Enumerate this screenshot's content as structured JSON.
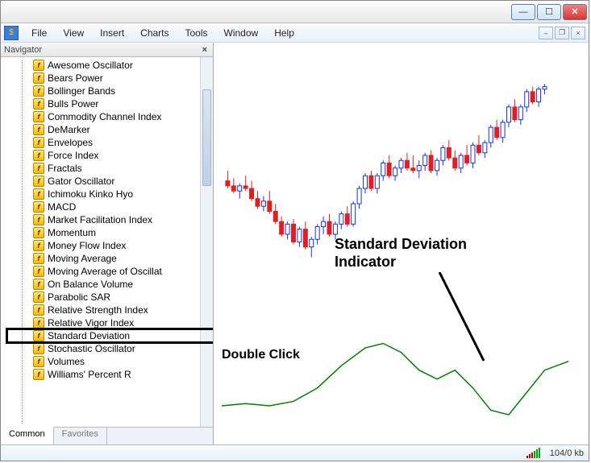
{
  "titlebar": {
    "min": "—",
    "max": "☐",
    "close": "✕"
  },
  "menu": {
    "items": [
      "File",
      "View",
      "Insert",
      "Charts",
      "Tools",
      "Window",
      "Help"
    ]
  },
  "mdi": {
    "min": "–",
    "restore": "❐",
    "close": "×"
  },
  "navigator": {
    "title": "Navigator",
    "close": "×",
    "items": [
      "Awesome Oscillator",
      "Bears Power",
      "Bollinger Bands",
      "Bulls Power",
      "Commodity Channel Index",
      "DeMarker",
      "Envelopes",
      "Force Index",
      "Fractals",
      "Gator Oscillator",
      "Ichimoku Kinko Hyo",
      "MACD",
      "Market Facilitation Index",
      "Momentum",
      "Money Flow Index",
      "Moving Average",
      "Moving Average of Oscillat",
      "On Balance Volume",
      "Parabolic SAR",
      "Relative Strength Index",
      "Relative Vigor Index",
      "Standard Deviation",
      "Stochastic Oscillator",
      "Volumes",
      "Williams' Percent R"
    ],
    "highlighted_index": 21,
    "tabs": {
      "common": "Common",
      "favorites": "Favorites",
      "active": 0
    }
  },
  "chart_data": {
    "type": "candlestick",
    "xrange": [
      0,
      60
    ],
    "yrange": [
      0,
      100
    ],
    "candles": [
      {
        "x": 1,
        "o": 52,
        "h": 56,
        "l": 49,
        "c": 50,
        "dir": "down"
      },
      {
        "x": 2,
        "o": 50,
        "h": 53,
        "l": 47,
        "c": 48,
        "dir": "down"
      },
      {
        "x": 3,
        "o": 48,
        "h": 51,
        "l": 45,
        "c": 50,
        "dir": "up"
      },
      {
        "x": 4,
        "o": 50,
        "h": 54,
        "l": 48,
        "c": 49,
        "dir": "down"
      },
      {
        "x": 5,
        "o": 49,
        "h": 52,
        "l": 44,
        "c": 45,
        "dir": "down"
      },
      {
        "x": 6,
        "o": 45,
        "h": 48,
        "l": 41,
        "c": 42,
        "dir": "down"
      },
      {
        "x": 7,
        "o": 42,
        "h": 46,
        "l": 40,
        "c": 44,
        "dir": "up"
      },
      {
        "x": 8,
        "o": 44,
        "h": 48,
        "l": 39,
        "c": 40,
        "dir": "down"
      },
      {
        "x": 9,
        "o": 40,
        "h": 43,
        "l": 35,
        "c": 36,
        "dir": "down"
      },
      {
        "x": 10,
        "o": 36,
        "h": 38,
        "l": 30,
        "c": 31,
        "dir": "down"
      },
      {
        "x": 11,
        "o": 31,
        "h": 36,
        "l": 29,
        "c": 35,
        "dir": "up"
      },
      {
        "x": 12,
        "o": 35,
        "h": 37,
        "l": 27,
        "c": 28,
        "dir": "down"
      },
      {
        "x": 13,
        "o": 28,
        "h": 34,
        "l": 26,
        "c": 33,
        "dir": "up"
      },
      {
        "x": 14,
        "o": 33,
        "h": 36,
        "l": 25,
        "c": 26,
        "dir": "down"
      },
      {
        "x": 15,
        "o": 26,
        "h": 30,
        "l": 22,
        "c": 29,
        "dir": "up"
      },
      {
        "x": 16,
        "o": 29,
        "h": 35,
        "l": 27,
        "c": 34,
        "dir": "up"
      },
      {
        "x": 17,
        "o": 34,
        "h": 38,
        "l": 31,
        "c": 36,
        "dir": "up"
      },
      {
        "x": 18,
        "o": 36,
        "h": 39,
        "l": 30,
        "c": 31,
        "dir": "down"
      },
      {
        "x": 19,
        "o": 31,
        "h": 36,
        "l": 29,
        "c": 35,
        "dir": "up"
      },
      {
        "x": 20,
        "o": 35,
        "h": 40,
        "l": 33,
        "c": 39,
        "dir": "up"
      },
      {
        "x": 21,
        "o": 39,
        "h": 42,
        "l": 34,
        "c": 35,
        "dir": "down"
      },
      {
        "x": 22,
        "o": 35,
        "h": 44,
        "l": 34,
        "c": 43,
        "dir": "up"
      },
      {
        "x": 23,
        "o": 43,
        "h": 50,
        "l": 41,
        "c": 49,
        "dir": "up"
      },
      {
        "x": 24,
        "o": 49,
        "h": 55,
        "l": 47,
        "c": 54,
        "dir": "up"
      },
      {
        "x": 25,
        "o": 54,
        "h": 56,
        "l": 48,
        "c": 49,
        "dir": "down"
      },
      {
        "x": 26,
        "o": 49,
        "h": 55,
        "l": 47,
        "c": 54,
        "dir": "up"
      },
      {
        "x": 27,
        "o": 54,
        "h": 60,
        "l": 52,
        "c": 59,
        "dir": "up"
      },
      {
        "x": 28,
        "o": 59,
        "h": 62,
        "l": 53,
        "c": 54,
        "dir": "down"
      },
      {
        "x": 29,
        "o": 54,
        "h": 58,
        "l": 52,
        "c": 57,
        "dir": "up"
      },
      {
        "x": 30,
        "o": 57,
        "h": 61,
        "l": 55,
        "c": 60,
        "dir": "up"
      },
      {
        "x": 31,
        "o": 60,
        "h": 63,
        "l": 56,
        "c": 57,
        "dir": "down"
      },
      {
        "x": 32,
        "o": 57,
        "h": 62,
        "l": 55,
        "c": 56,
        "dir": "down"
      },
      {
        "x": 33,
        "o": 56,
        "h": 60,
        "l": 53,
        "c": 58,
        "dir": "up"
      },
      {
        "x": 34,
        "o": 58,
        "h": 63,
        "l": 56,
        "c": 62,
        "dir": "up"
      },
      {
        "x": 35,
        "o": 62,
        "h": 64,
        "l": 55,
        "c": 56,
        "dir": "down"
      },
      {
        "x": 36,
        "o": 56,
        "h": 61,
        "l": 54,
        "c": 60,
        "dir": "up"
      },
      {
        "x": 37,
        "o": 60,
        "h": 66,
        "l": 58,
        "c": 65,
        "dir": "up"
      },
      {
        "x": 38,
        "o": 65,
        "h": 68,
        "l": 60,
        "c": 61,
        "dir": "down"
      },
      {
        "x": 39,
        "o": 61,
        "h": 64,
        "l": 56,
        "c": 57,
        "dir": "down"
      },
      {
        "x": 40,
        "o": 57,
        "h": 63,
        "l": 55,
        "c": 62,
        "dir": "up"
      },
      {
        "x": 41,
        "o": 62,
        "h": 66,
        "l": 58,
        "c": 59,
        "dir": "down"
      },
      {
        "x": 42,
        "o": 59,
        "h": 67,
        "l": 57,
        "c": 66,
        "dir": "up"
      },
      {
        "x": 43,
        "o": 66,
        "h": 70,
        "l": 62,
        "c": 63,
        "dir": "down"
      },
      {
        "x": 44,
        "o": 63,
        "h": 68,
        "l": 61,
        "c": 67,
        "dir": "up"
      },
      {
        "x": 45,
        "o": 67,
        "h": 74,
        "l": 65,
        "c": 73,
        "dir": "up"
      },
      {
        "x": 46,
        "o": 73,
        "h": 76,
        "l": 68,
        "c": 69,
        "dir": "down"
      },
      {
        "x": 47,
        "o": 69,
        "h": 76,
        "l": 67,
        "c": 75,
        "dir": "up"
      },
      {
        "x": 48,
        "o": 75,
        "h": 82,
        "l": 73,
        "c": 81,
        "dir": "up"
      },
      {
        "x": 49,
        "o": 81,
        "h": 84,
        "l": 75,
        "c": 76,
        "dir": "down"
      },
      {
        "x": 50,
        "o": 76,
        "h": 82,
        "l": 74,
        "c": 81,
        "dir": "up"
      },
      {
        "x": 51,
        "o": 81,
        "h": 88,
        "l": 79,
        "c": 87,
        "dir": "up"
      },
      {
        "x": 52,
        "o": 87,
        "h": 89,
        "l": 82,
        "c": 83,
        "dir": "down"
      },
      {
        "x": 53,
        "o": 83,
        "h": 89,
        "l": 81,
        "c": 88,
        "dir": "up"
      },
      {
        "x": 54,
        "o": 88,
        "h": 90,
        "l": 86,
        "c": 89,
        "dir": "up"
      }
    ],
    "indicator_line": {
      "color": "#008000",
      "points": [
        {
          "x": 0,
          "y": 12
        },
        {
          "x": 4,
          "y": 13
        },
        {
          "x": 8,
          "y": 12
        },
        {
          "x": 12,
          "y": 14
        },
        {
          "x": 16,
          "y": 20
        },
        {
          "x": 20,
          "y": 30
        },
        {
          "x": 24,
          "y": 38
        },
        {
          "x": 27,
          "y": 40
        },
        {
          "x": 30,
          "y": 36
        },
        {
          "x": 33,
          "y": 28
        },
        {
          "x": 36,
          "y": 24
        },
        {
          "x": 39,
          "y": 28
        },
        {
          "x": 42,
          "y": 20
        },
        {
          "x": 45,
          "y": 10
        },
        {
          "x": 48,
          "y": 8
        },
        {
          "x": 51,
          "y": 18
        },
        {
          "x": 54,
          "y": 28
        },
        {
          "x": 58,
          "y": 32
        }
      ]
    }
  },
  "annotations": {
    "title1": "Standard Deviation",
    "title2": "Indicator",
    "dblclick": "Double Click"
  },
  "status": {
    "kb": "104/0 kb"
  }
}
